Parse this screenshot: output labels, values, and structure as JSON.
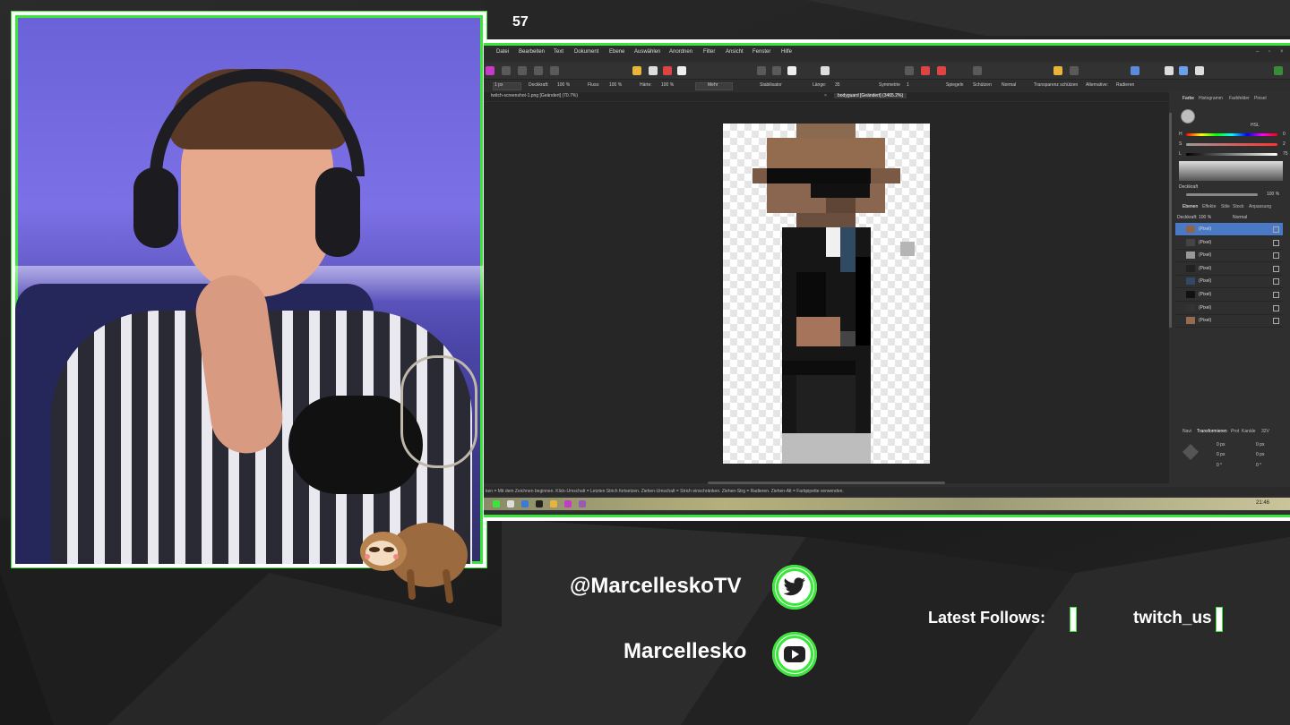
{
  "stream": {
    "viewer_count": "57",
    "twitter_handle": "@MarcelleskoTV",
    "youtube_channel": "Marcellesko",
    "latest_follows_label": "Latest Follows:",
    "latest_follow_user": "twitch_us"
  },
  "colors": {
    "accent": "#39e639",
    "frame": "#ffffff",
    "background": "#232323"
  },
  "icons": {
    "twitter": "twitter-bird-icon",
    "youtube": "youtube-play-icon",
    "mascot": "sloth-mascot"
  },
  "app": {
    "menu": [
      "Datei",
      "Bearbeiten",
      "Text",
      "Dokument",
      "Ebene",
      "Auswählen",
      "Anordnen",
      "Filter",
      "Ansicht",
      "Fenster",
      "Hilfe"
    ],
    "context": {
      "size": "1 px",
      "opacity_label": "Deckkraft:",
      "opacity": "100 %",
      "flow_label": "Fluss:",
      "flow": "100 %",
      "hardness_label": "Härte:",
      "hardness": "100 %",
      "more": "Mehr",
      "stabilizer": "Stabilisator",
      "length_label": "Länge:",
      "length": "35",
      "symmetry": "Symmetrie",
      "symmetry_val": "1",
      "mirror": "Spiegeln",
      "protect": "Schützen",
      "blend": "Normal",
      "protect_alpha": "Transparenz schützen",
      "alternative_label": "Alternative:",
      "alternative": "Radieren"
    },
    "tabs": [
      "twitch-screenshot-1.png [Geändert] (70.7%)",
      "bodyguard [Geändert] (3465.2%)"
    ],
    "status": "ken = Mit dem Zeichnen beginnen. Klick-Umschalt = Letzten Strich fortsetzen. Ziehen-Umschalt = Strich einschränken. Ziehen-Strg = Radieren. Ziehen-Alt = Farbpipette verwenden.",
    "right_panel": {
      "top_tabs": [
        "Farbe",
        "Histogramm",
        "Farbfelder",
        "Pinsel"
      ],
      "color_mode": "HSL",
      "h_label": "H",
      "h_value": "0",
      "s_label": "S",
      "s_value": "2",
      "l_label": "L",
      "l_value": "75",
      "opacity_label": "Deckkraft",
      "opacity_value": "100 %",
      "layer_tabs": [
        "Ebenen",
        "Effekte",
        "Stile",
        "Stock",
        "Anpassung"
      ],
      "layer_opacity_label": "Deckkraft:",
      "layer_opacity": "100 %",
      "layer_blend": "Normal",
      "layers": [
        "(Pixel)",
        "(Pixel)",
        "(Pixel)",
        "(Pixel)",
        "(Pixel)",
        "(Pixel)",
        "(Pixel)",
        "(Pixel)"
      ],
      "bottom_tabs": [
        "Navi",
        "Transformieren",
        "Prot",
        "Kanäle",
        "32V"
      ],
      "transform_vals": [
        "0 px",
        "0 px",
        "0 px",
        "0 px",
        "0 °",
        "0 °"
      ]
    },
    "clock": "21:46"
  }
}
